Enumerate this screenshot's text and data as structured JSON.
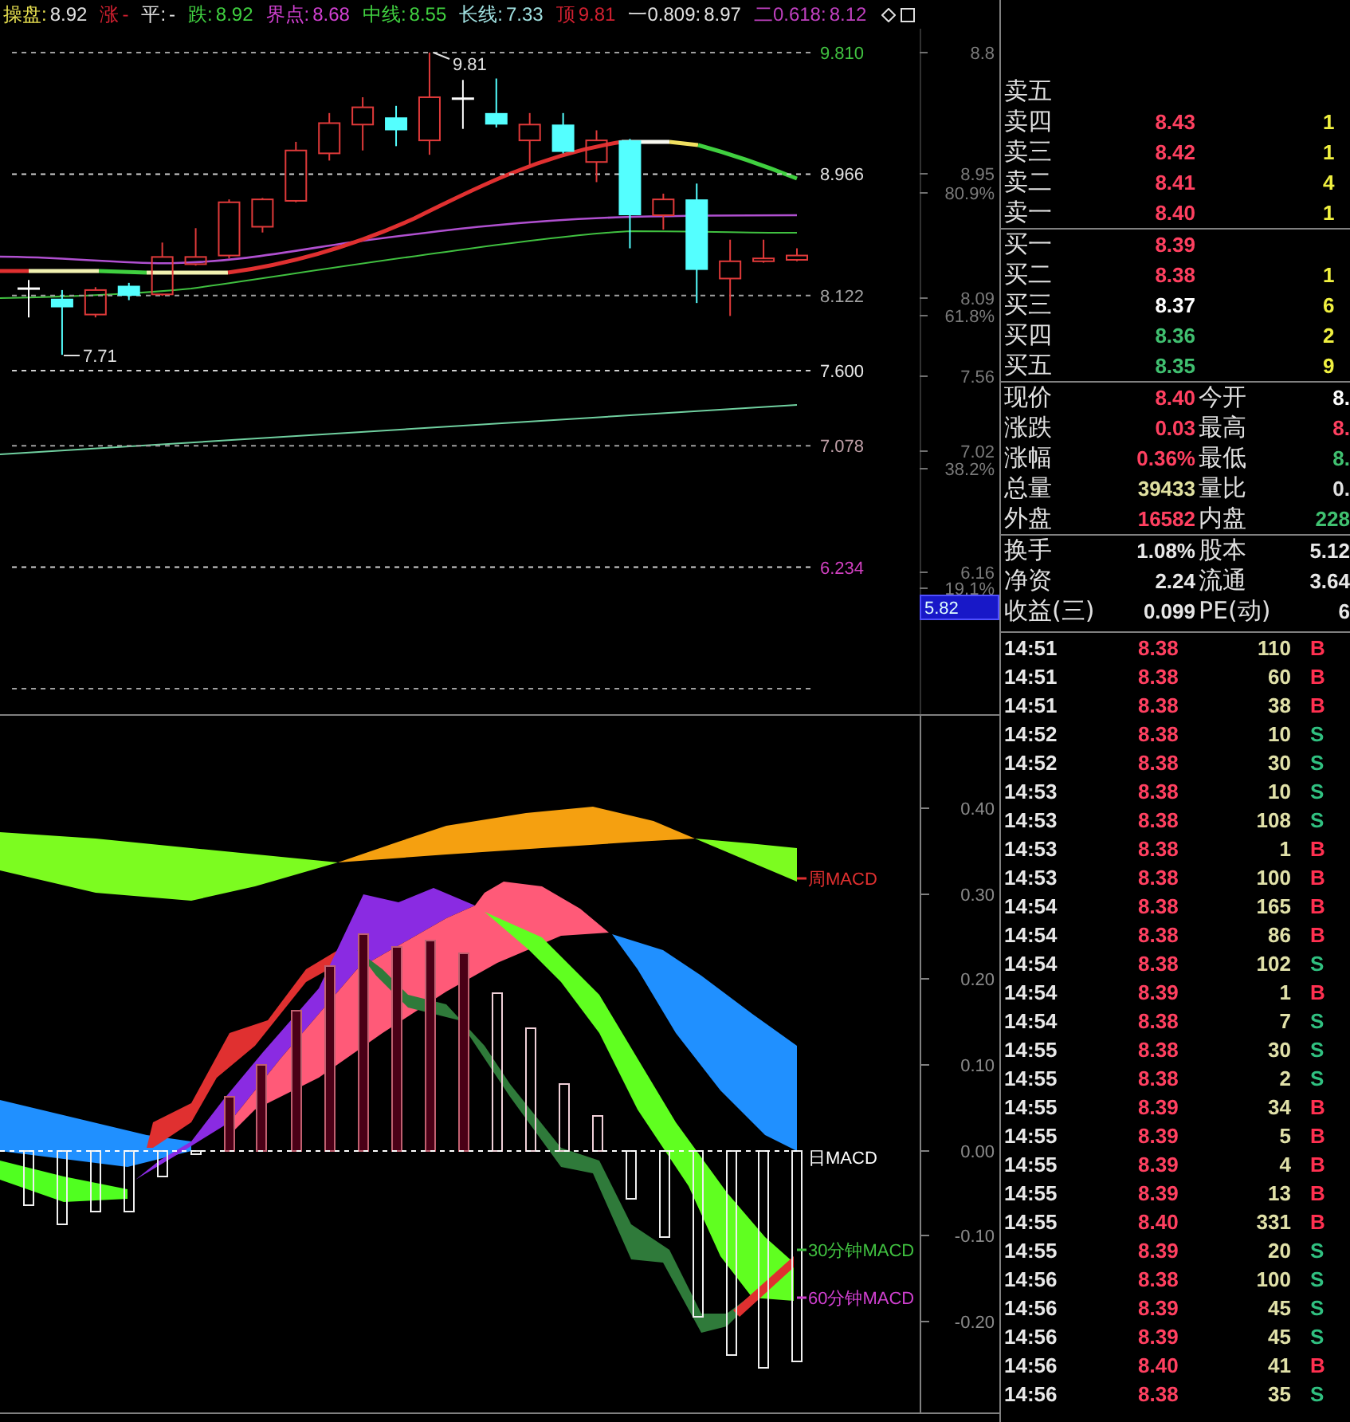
{
  "header": {
    "items": [
      {
        "kind": "label",
        "text": "操盘:",
        "color": "#e8e050"
      },
      {
        "kind": "value",
        "text": "8.92",
        "color": "#e0e0e0"
      },
      {
        "kind": "label",
        "text": "涨",
        "color": "#d02030"
      },
      {
        "kind": "value",
        "text": "-",
        "color": "#d02030"
      },
      {
        "kind": "label",
        "text": "平:",
        "color": "#e0e0e0"
      },
      {
        "kind": "value",
        "text": "-",
        "color": "#e0e0e0"
      },
      {
        "kind": "label",
        "text": "跌:",
        "color": "#40d040"
      },
      {
        "kind": "value",
        "text": "8.92",
        "color": "#40d040"
      },
      {
        "kind": "label",
        "text": "界点:",
        "color": "#d040d0"
      },
      {
        "kind": "value",
        "text": "8.68",
        "color": "#d040d0"
      },
      {
        "kind": "label",
        "text": "中线:",
        "color": "#40d040"
      },
      {
        "kind": "value",
        "text": "8.55",
        "color": "#40d040"
      },
      {
        "kind": "label",
        "text": "长线:",
        "color": "#a0e0e0"
      },
      {
        "kind": "value",
        "text": "7.33",
        "color": "#a0e0e0"
      },
      {
        "kind": "label",
        "text": "顶",
        "color": "#d02030"
      },
      {
        "kind": "value",
        "text": "9.81",
        "color": "#d02030"
      },
      {
        "kind": "label",
        "text": "一0.809:",
        "color": "#e0e0e0"
      },
      {
        "kind": "value",
        "text": "8.97",
        "color": "#e0e0e0"
      },
      {
        "kind": "label",
        "text": "二0.618:",
        "color": "#c040c0"
      },
      {
        "kind": "value",
        "text": "8.12",
        "color": "#c040c0"
      }
    ]
  },
  "price_chart": {
    "chart_data": {
      "type": "candlestick",
      "categories": [
        null,
        null,
        null,
        null,
        null,
        null,
        null,
        null,
        null,
        null,
        null,
        null,
        null,
        null,
        null,
        null,
        null,
        null,
        null,
        null,
        null,
        null,
        null,
        null
      ],
      "ohlc": [
        [
          8.17,
          8.23,
          7.97,
          8.17
        ],
        [
          8.1,
          8.16,
          7.71,
          8.04
        ],
        [
          7.99,
          8.18,
          7.97,
          8.16
        ],
        [
          8.19,
          8.21,
          8.09,
          8.12
        ],
        [
          8.13,
          8.49,
          8.12,
          8.39
        ],
        [
          8.34,
          8.59,
          8.33,
          8.39
        ],
        [
          8.4,
          8.79,
          8.38,
          8.77
        ],
        [
          8.6,
          8.8,
          8.56,
          8.79
        ],
        [
          8.78,
          9.19,
          8.77,
          9.13
        ],
        [
          9.11,
          9.39,
          9.06,
          9.32
        ],
        [
          9.31,
          9.5,
          9.13,
          9.43
        ],
        [
          9.36,
          9.44,
          9.16,
          9.27
        ],
        [
          9.2,
          9.81,
          9.1,
          9.5
        ],
        [
          9.49,
          9.62,
          9.28,
          9.49
        ],
        [
          9.39,
          9.63,
          9.29,
          9.31
        ],
        [
          9.2,
          9.39,
          9.02,
          9.31
        ],
        [
          9.31,
          9.39,
          9.11,
          9.12
        ],
        [
          9.05,
          9.27,
          8.91,
          9.2
        ],
        [
          9.2,
          9.21,
          8.45,
          8.68
        ],
        [
          8.68,
          8.83,
          8.58,
          8.79
        ],
        [
          8.79,
          8.9,
          8.07,
          8.3
        ],
        [
          8.24,
          8.51,
          7.98,
          8.36
        ],
        [
          8.36,
          8.51,
          8.35,
          8.38
        ],
        [
          8.37,
          8.45,
          8.36,
          8.4
        ]
      ],
      "ylim": [
        5.39,
        9.81
      ],
      "yticks": [
        {
          "value": 9.81,
          "label": "9.810"
        },
        {
          "value": 8.966,
          "label": "8.966"
        },
        {
          "value": 8.122,
          "label": "8.122"
        },
        {
          "value": 7.6,
          "label": "7.600"
        },
        {
          "value": 7.078,
          "label": "7.078"
        },
        {
          "value": 6.234,
          "label": "6.234"
        }
      ],
      "grid": true
    },
    "level_labels": [
      {
        "color": "#40c040"
      },
      {
        "color": "#e0e0e0"
      },
      {
        "color": "#a0a0a0"
      },
      {
        "color": "#e8e8e8"
      },
      {
        "color": "#c0a0a8"
      },
      {
        "color": "#d040c0"
      }
    ],
    "annotations": [
      "9.81",
      "7.71"
    ],
    "axis_labels": [
      "8.8",
      "8.95",
      "80.9%",
      "8.09",
      "61.8%",
      "7.56",
      "7.02",
      "38.2%",
      "6.16",
      "19.1%"
    ],
    "cursor_price": "5.82"
  },
  "macd_chart": {
    "series_labels": [
      {
        "label": "周MACD",
        "color": "#e03030"
      },
      {
        "label": "日MACD",
        "color": "#ffffff"
      },
      {
        "label": "30分钟MACD",
        "color": "#40c040"
      },
      {
        "label": "60分钟MACD",
        "color": "#d040d0"
      }
    ],
    "axis_labels": [
      "0.40",
      "0.30",
      "0.20",
      "0.10",
      "0.00",
      "-0.10",
      "-0.20"
    ]
  },
  "order_book": {
    "asks": [
      {
        "label": "卖五"
      },
      {
        "label": "卖四",
        "price": "8.43",
        "volume": "1",
        "color": "#ff4060"
      },
      {
        "label": "卖三",
        "price": "8.42",
        "volume": "1",
        "color": "#ff4060"
      },
      {
        "label": "卖二",
        "price": "8.41",
        "volume": "4",
        "color": "#ff4060"
      },
      {
        "label": "卖一",
        "price": "8.40",
        "volume": "1",
        "color": "#ff4060"
      }
    ],
    "bids": [
      {
        "label": "买一",
        "price": "8.39",
        "color": "#ff4060"
      },
      {
        "label": "买二",
        "price": "8.38",
        "volume": "1",
        "color": "#ff4060"
      },
      {
        "label": "买三",
        "price": "8.37",
        "volume": "6",
        "color": "#ffffff"
      },
      {
        "label": "买四",
        "price": "8.36",
        "volume": "2",
        "color": "#40c070"
      },
      {
        "label": "买五",
        "price": "8.35",
        "volume": "9",
        "color": "#40c070"
      }
    ]
  },
  "quote": [
    {
      "cells": [
        {
          "label": "现价",
          "value": "8.40",
          "color": "#ff4060"
        },
        {
          "label": "今开",
          "value": "8.",
          "color": "#ffffff"
        }
      ]
    },
    {
      "cells": [
        {
          "label": "涨跌",
          "value": "0.03",
          "color": "#ff4060"
        },
        {
          "label": "最高",
          "value": "8.",
          "color": "#ff4060"
        }
      ]
    },
    {
      "cells": [
        {
          "label": "涨幅",
          "value": "0.36%",
          "color": "#ff4060"
        },
        {
          "label": "最低",
          "value": "8.",
          "color": "#40c070"
        }
      ]
    },
    {
      "cells": [
        {
          "label": "总量",
          "value": "39433",
          "color": "#e0e0a0"
        },
        {
          "label": "量比",
          "value": "0.",
          "color": "#e0e0e0"
        }
      ]
    },
    {
      "cells": [
        {
          "label": "外盘",
          "value": "16582",
          "color": "#ff4060"
        },
        {
          "label": "内盘",
          "value": "228",
          "color": "#40c070"
        }
      ]
    }
  ],
  "stats": [
    {
      "cells": [
        {
          "label": "换手",
          "value": "1.08%"
        },
        {
          "label": "股本",
          "value": "5.12"
        }
      ]
    },
    {
      "cells": [
        {
          "label": "净资",
          "value": "2.24"
        },
        {
          "label": "流通",
          "value": "3.64"
        }
      ]
    },
    {
      "cells": [
        {
          "label": "收益(三)",
          "value": "0.099"
        },
        {
          "label": "PE(动)",
          "value": "6"
        }
      ]
    }
  ],
  "ticks": [
    {
      "time": "14:51",
      "price": "8.38",
      "volume": "110",
      "side": "B",
      "color": "#ff3050"
    },
    {
      "time": "14:51",
      "price": "8.38",
      "volume": "60",
      "side": "B",
      "color": "#ff3050"
    },
    {
      "time": "14:51",
      "price": "8.38",
      "volume": "38",
      "side": "B",
      "color": "#ff3050"
    },
    {
      "time": "14:52",
      "price": "8.38",
      "volume": "10",
      "side": "S",
      "color": "#30c080"
    },
    {
      "time": "14:52",
      "price": "8.38",
      "volume": "30",
      "side": "S",
      "color": "#30c080"
    },
    {
      "time": "14:53",
      "price": "8.38",
      "volume": "10",
      "side": "S",
      "color": "#30c080"
    },
    {
      "time": "14:53",
      "price": "8.38",
      "volume": "108",
      "side": "S",
      "color": "#30c080"
    },
    {
      "time": "14:53",
      "price": "8.38",
      "volume": "1",
      "side": "B",
      "color": "#ff3050"
    },
    {
      "time": "14:53",
      "price": "8.38",
      "volume": "100",
      "side": "B",
      "color": "#ff3050"
    },
    {
      "time": "14:54",
      "price": "8.38",
      "volume": "165",
      "side": "B",
      "color": "#ff3050"
    },
    {
      "time": "14:54",
      "price": "8.38",
      "volume": "86",
      "side": "B",
      "color": "#ff3050"
    },
    {
      "time": "14:54",
      "price": "8.38",
      "volume": "102",
      "side": "S",
      "color": "#30c080"
    },
    {
      "time": "14:54",
      "price": "8.39",
      "volume": "1",
      "side": "B",
      "color": "#ff3050"
    },
    {
      "time": "14:54",
      "price": "8.38",
      "volume": "7",
      "side": "S",
      "color": "#30c080"
    },
    {
      "time": "14:55",
      "price": "8.38",
      "volume": "30",
      "side": "S",
      "color": "#30c080"
    },
    {
      "time": "14:55",
      "price": "8.38",
      "volume": "2",
      "side": "S",
      "color": "#30c080"
    },
    {
      "time": "14:55",
      "price": "8.39",
      "volume": "34",
      "side": "B",
      "color": "#ff3050"
    },
    {
      "time": "14:55",
      "price": "8.39",
      "volume": "5",
      "side": "B",
      "color": "#ff3050"
    },
    {
      "time": "14:55",
      "price": "8.39",
      "volume": "4",
      "side": "B",
      "color": "#ff3050"
    },
    {
      "time": "14:55",
      "price": "8.39",
      "volume": "13",
      "side": "B",
      "color": "#ff3050"
    },
    {
      "time": "14:55",
      "price": "8.40",
      "volume": "331",
      "side": "B",
      "color": "#ff3050"
    },
    {
      "time": "14:55",
      "price": "8.39",
      "volume": "20",
      "side": "S",
      "color": "#30c080"
    },
    {
      "time": "14:56",
      "price": "8.38",
      "volume": "100",
      "side": "S",
      "color": "#30c080"
    },
    {
      "time": "14:56",
      "price": "8.39",
      "volume": "45",
      "side": "S",
      "color": "#30c080"
    },
    {
      "time": "14:56",
      "price": "8.39",
      "volume": "45",
      "side": "S",
      "color": "#30c080"
    },
    {
      "time": "14:56",
      "price": "8.40",
      "volume": "41",
      "side": "B",
      "color": "#ff3050"
    },
    {
      "time": "14:56",
      "price": "8.38",
      "volume": "35",
      "side": "S",
      "color": "#30c080"
    }
  ]
}
